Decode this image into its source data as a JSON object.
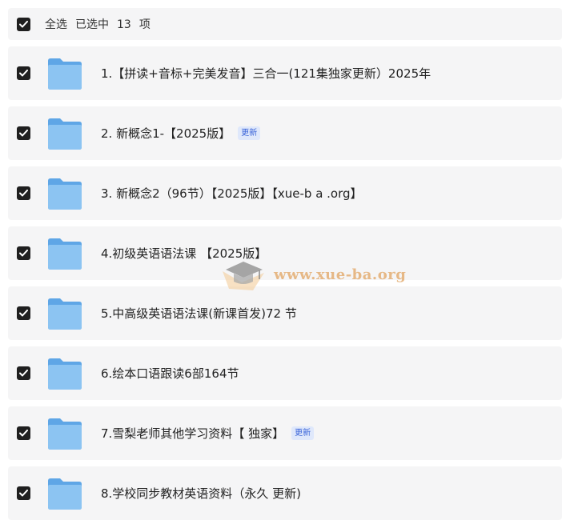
{
  "header": {
    "select_all": "全选",
    "selected_prefix": "已选中",
    "selected_count": "13",
    "selected_suffix": "项"
  },
  "items": [
    {
      "title": "1.【拼读+音标+完美发音】三合一(121集独家更新）2025年",
      "checked": true,
      "icon": "folder-icon"
    },
    {
      "title": "2. 新概念1-【2025版】",
      "badge": "更新",
      "checked": true,
      "icon": "folder-icon"
    },
    {
      "title": "3. 新概念2（96节）【2025版】【xue-b a .org】",
      "checked": true,
      "icon": "folder-icon"
    },
    {
      "title": "4.初级英语语法课 【2025版】",
      "checked": true,
      "icon": "folder-icon"
    },
    {
      "title": "5.中高级英语语法课(新课首发)72 节",
      "checked": true,
      "icon": "folder-icon"
    },
    {
      "title": "6.绘本口语跟读6部164节",
      "checked": true,
      "icon": "folder-icon"
    },
    {
      "title": "7.雪梨老师其他学习资料【 独家】",
      "badge": "更新",
      "checked": true,
      "icon": "folder-icon"
    },
    {
      "title": "8.学校同步教材英语资料（永久 更新)",
      "checked": true,
      "icon": "folder-icon"
    }
  ],
  "watermark": {
    "text": "www.xue-ba.org"
  },
  "colors": {
    "row_bg": "#f5f5f6",
    "checkbox": "#1f1f1f",
    "folder_light": "#8cc4f2",
    "folder_dark": "#5fa6e6",
    "badge_text": "#3a64d8",
    "badge_bg": "#dfe8fb",
    "watermark": "#e5b27a"
  }
}
